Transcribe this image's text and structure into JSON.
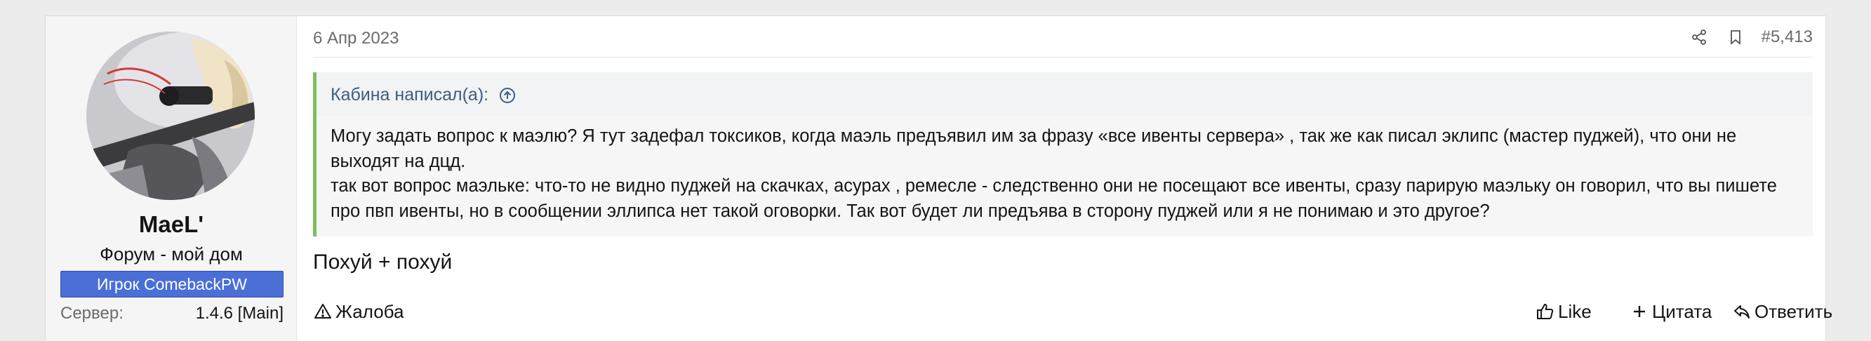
{
  "user": {
    "username": "MaeL'",
    "title": "Форум - мой дом",
    "banner": "Игрок ComebackPW",
    "extra_label": "Сервер:",
    "extra_value": "1.4.6 [Main]"
  },
  "post": {
    "date": "6 Апр 2023",
    "number": "#5,413",
    "icons": {
      "share": "share-icon",
      "bookmark": "bookmark-icon"
    }
  },
  "quote": {
    "author": "Кабина написал(а):",
    "paragraph1": "Могу задать вопрос к маэлю? Я тут задефал токсиков, когда маэль предъявил им за фразу «все ивенты сервера» , так же как писал эклипс (мастер пуджей), что они не выходят на дцд.",
    "paragraph2": "так вот вопрос маэльке: что-то не видно пуджей на скачках, асурах , ремесле - следственно они не посещают все ивенты, сразу парирую маэльку он говорил, что вы пишете про пвп ивенты, но в сообщении эллипса нет такой оговорки. Так вот будет ли предъява в сторону пуджей или я не понимаю и это другое?"
  },
  "message": "Похуй + похуй",
  "actions": {
    "report": "Жалоба",
    "like": "Like",
    "quote": "Цитата",
    "reply": "Ответить"
  },
  "colors": {
    "banner_bg": "#4a6fd6",
    "quote_border": "#7cbf5f",
    "quote_author": "#3d5d80"
  }
}
